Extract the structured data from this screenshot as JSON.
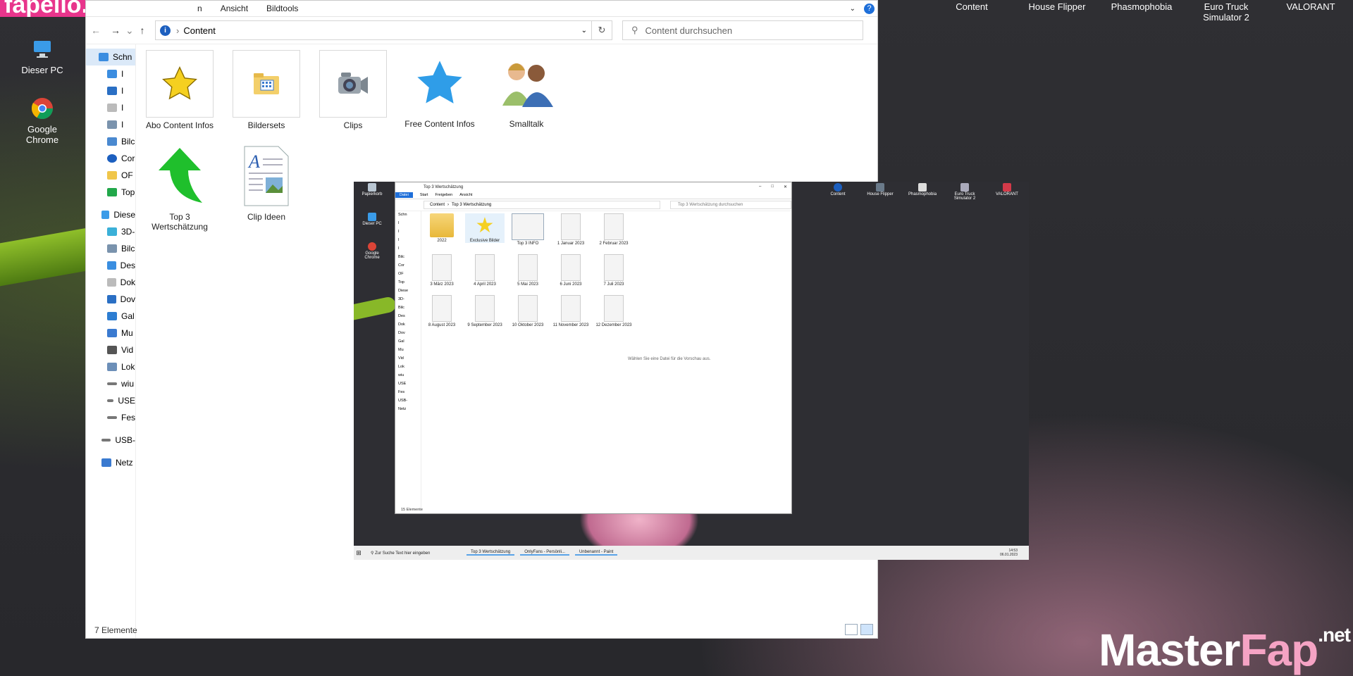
{
  "watermarks": {
    "top": "fapello.com",
    "bottom_main": "Master",
    "bottom_accent": "Fap",
    "bottom_suffix": ".net"
  },
  "desktop_icons": [
    {
      "label": "Dieser PC",
      "icon": "computer-icon"
    },
    {
      "label": "Google Chrome",
      "icon": "chrome-icon"
    }
  ],
  "top_apps": [
    "Content",
    "House Flipper",
    "Phasmophobia",
    "Euro Truck Simulator 2",
    "VALORANT"
  ],
  "explorer": {
    "ribbon_tabs": [
      "n",
      "Ansicht",
      "Bildtools"
    ],
    "address": {
      "path": "Content"
    },
    "search": {
      "placeholder": "Content durchsuchen"
    },
    "nav_items": [
      "Schn",
      "I",
      "I",
      "I",
      "I",
      "Bilc",
      "Cor",
      "OF",
      "Top",
      "Diese",
      "3D-",
      "Bilc",
      "Des",
      "Dok",
      "Dov",
      "Gal",
      "Mu",
      "Vid",
      "Lok",
      "wiu",
      "USE",
      "Fes",
      "USB-",
      "Netz"
    ],
    "files": [
      {
        "label": "Abo Content Infos",
        "icon": "star-icon"
      },
      {
        "label": "Bildersets",
        "icon": "folder-picture-icon"
      },
      {
        "label": "Clips",
        "icon": "camera-icon"
      },
      {
        "label": "Free Content Infos",
        "icon": "blue-star-icon"
      },
      {
        "label": "Smalltalk",
        "icon": "people-icon"
      },
      {
        "label": "Top 3 Wertschätzung",
        "icon": "green-arrow-icon"
      },
      {
        "label": "Clip Ideen",
        "icon": "document-icon"
      }
    ],
    "status": "7 Elemente"
  },
  "screenshot": {
    "desktop_icons": [
      "Papierkorb",
      "Dieser PC",
      "Google Chrome"
    ],
    "top_apps": [
      "Content",
      "House Flipper",
      "Phasmophobia",
      "Euro Truck Simulator 2",
      "VALORANT"
    ],
    "window": {
      "title": "Top 3 Wertschätzung",
      "ribbon_tabs": [
        "Datei",
        "Start",
        "Freigeben",
        "Ansicht"
      ],
      "breadcrumb": [
        "Content",
        "Top 3 Wertschätzung"
      ],
      "search_placeholder": "Top 3 Wertschätzung durchsuchen",
      "nav_items": [
        "Schn",
        "I",
        "I",
        "I",
        "I",
        "Bilc",
        "Cor",
        "OF",
        "Top",
        "Diese",
        "3D-",
        "Bilc",
        "Des",
        "Dok",
        "Dov",
        "Gal",
        "Mu",
        "Vid",
        "Lok",
        "wiu",
        "USE",
        "Fes",
        "USB-",
        "Netz"
      ],
      "files": [
        "2022",
        "Exclusive Bilder",
        "Top 3 INFO",
        "1 Januar 2023",
        "2 Februar 2023",
        "3 März 2023",
        "4 April 2023",
        "5 Mai 2023",
        "6 Juni 2023",
        "7 Juli 2023",
        "8 August 2023",
        "9 September 2023",
        "10 Oktober 2023",
        "11 November 2023",
        "12 Dezember 2023"
      ],
      "preview_text": "Wählen Sie eine Datei für die Vorschau aus.",
      "status": "15 Elemente"
    },
    "taskbar": {
      "search": "Zur Suche Text hier eingeben",
      "tasks": [
        "Top 3 Wertschätzung",
        "OnlyFans - Persönli...",
        "Unbenannt - Paint"
      ],
      "time": "14:53",
      "date": "06.01.2023"
    }
  }
}
